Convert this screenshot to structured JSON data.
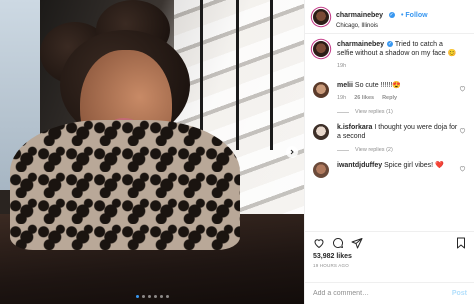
{
  "post": {
    "username": "charmainebey",
    "follow_label": "Follow",
    "location": "Chicago, Illinois",
    "likes": "53,982 likes",
    "time_ago": "19 HOURS AGO"
  },
  "caption": {
    "username": "charmainebey",
    "text": "Tried to catch a selfie without a shadow on my face 😊",
    "time": "19h"
  },
  "comments": [
    {
      "username": "melii",
      "text": "So cute !!!!!!😍",
      "time": "19h",
      "likes": "26 likes",
      "reply": "Reply",
      "view_replies": "View replies (1)"
    },
    {
      "username": "k.isforkara",
      "text": "I thought you were doja for a second",
      "time": "",
      "likes": "",
      "reply": "",
      "view_replies": "View replies (2)"
    },
    {
      "username": "iwantdjduffey",
      "text": "Spice girl vibes! ❤️",
      "time": "",
      "likes": "",
      "reply": "",
      "view_replies": ""
    }
  ],
  "add_comment": {
    "placeholder": "Add a comment…",
    "post_label": "Post"
  },
  "icons": [
    "verified-badge-icon",
    "heart-icon",
    "comment-icon",
    "share-icon",
    "bookmark-icon",
    "chevron-right-icon"
  ],
  "colors": {
    "accent": "#3897f0",
    "muted": "#8e8e8e",
    "post_disabled": "#b2dffc",
    "ring": "#c13584"
  }
}
